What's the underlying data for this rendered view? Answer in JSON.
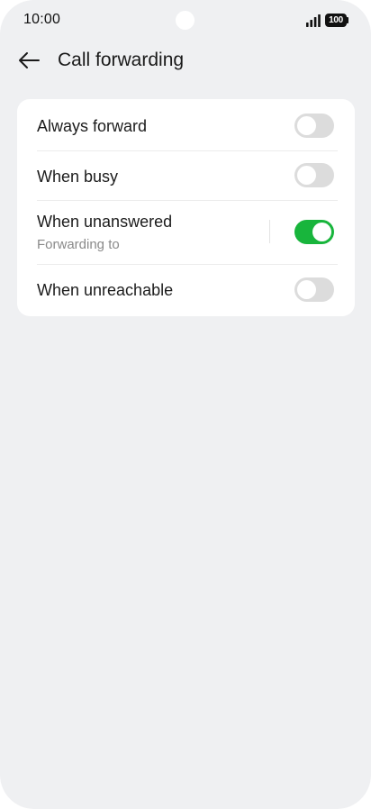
{
  "status_bar": {
    "time": "10:00",
    "battery": "100",
    "signal_icon": "signal-bars-icon",
    "battery_icon": "battery-icon"
  },
  "app_bar": {
    "back_icon": "back-arrow-icon",
    "title": "Call forwarding"
  },
  "settings": [
    {
      "label": "Always forward",
      "sublabel": "",
      "enabled": false
    },
    {
      "label": "When busy",
      "sublabel": "",
      "enabled": false
    },
    {
      "label": "When unanswered",
      "sublabel": "Forwarding to",
      "enabled": true
    },
    {
      "label": "When unreachable",
      "sublabel": "",
      "enabled": false
    }
  ],
  "colors": {
    "toggle_on": "#18b53c",
    "toggle_off": "#dcdcdc",
    "background": "#eff0f2",
    "card": "#ffffff"
  }
}
